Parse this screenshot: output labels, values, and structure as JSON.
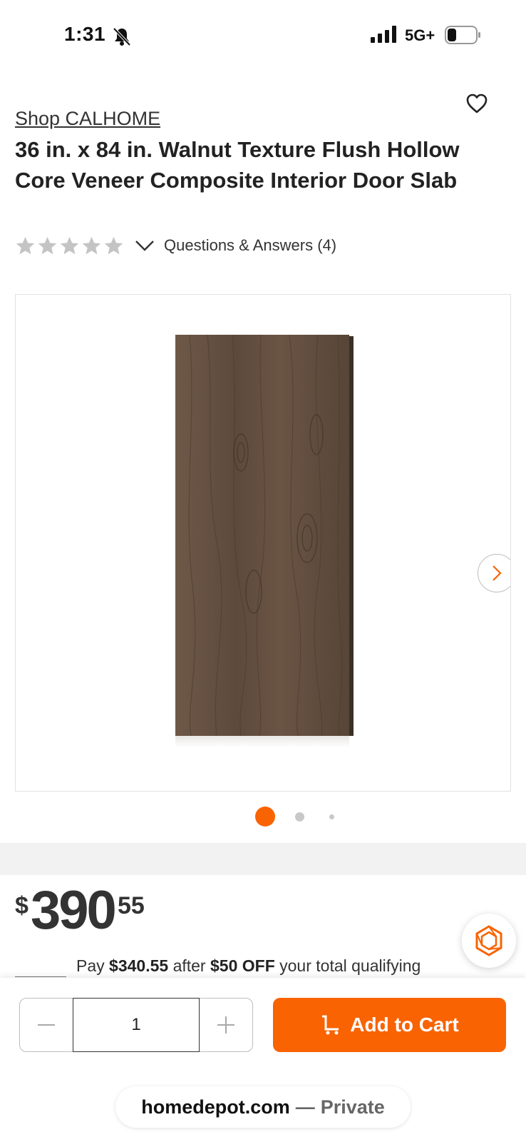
{
  "status_bar": {
    "time": "1:31",
    "network": "5G+",
    "icons": [
      "bell-slash-icon",
      "signal-icon",
      "battery-icon"
    ]
  },
  "product": {
    "shop_link": "Shop CALHOME",
    "title": "36 in. x 84 in. Walnut Texture Flush Hollow Core Veneer Composite Interior Door Slab",
    "rating_stars": 0,
    "rating_max": 5,
    "qa_label": "Questions & Answers (4)"
  },
  "gallery": {
    "image_alt": "Walnut texture door slab",
    "image_count": 3,
    "active_index": 0
  },
  "price": {
    "currency": "$",
    "dollars": "390",
    "cents": "55",
    "promo": {
      "pay_prefix": "Pay",
      "pay_amount": "$340.55",
      "after_text": "after",
      "discount": "$50 OFF",
      "suffix": "your total qualifying"
    }
  },
  "cart": {
    "quantity": "1",
    "add_label": "Add to Cart"
  },
  "browser": {
    "domain": "homedepot.com",
    "separator": "—",
    "mode": "Private"
  },
  "colors": {
    "accent": "#f96302",
    "star": "#c4c4c4",
    "text": "#222222"
  }
}
